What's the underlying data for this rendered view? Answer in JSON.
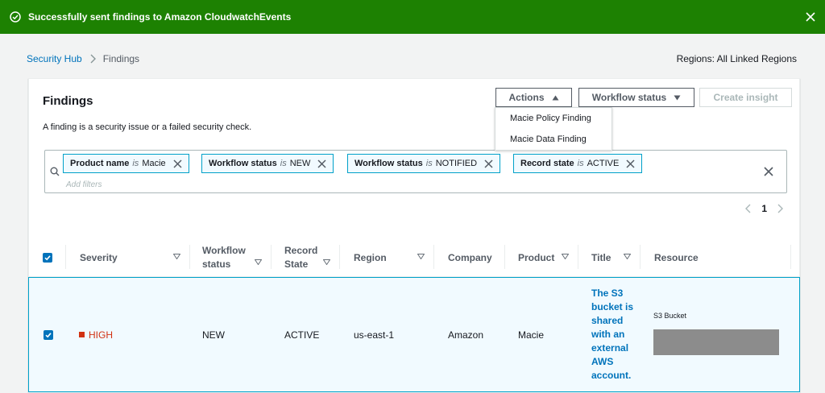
{
  "flash": {
    "message": "Successfully sent findings to Amazon CloudwatchEvents",
    "icon": "check-circle-icon",
    "close_icon": "close-icon",
    "color": "#1d8102"
  },
  "breadcrumb": {
    "parent": "Security Hub",
    "current": "Findings"
  },
  "regions": "Regions: All Linked Regions",
  "findings": {
    "title": "Findings",
    "description": "A finding is a security issue or a failed security check.",
    "actions_label": "Actions",
    "workflow_label": "Workflow status",
    "create_insight_label": "Create insight",
    "actions_menu": [
      "Macie Policy Finding",
      "Macie Data Finding"
    ]
  },
  "filters": {
    "tokens": [
      {
        "key": "Product name",
        "op": "is",
        "value": "Macie"
      },
      {
        "key": "Workflow status",
        "op": "is",
        "value": "NEW"
      },
      {
        "key": "Workflow status",
        "op": "is",
        "value": "NOTIFIED"
      },
      {
        "key": "Record state",
        "op": "is",
        "value": "ACTIVE"
      }
    ],
    "placeholder": "Add filters"
  },
  "pagination": {
    "current_page": "1"
  },
  "table": {
    "columns": {
      "severity": "Severity",
      "workflow_line1": "Workflow",
      "workflow_line2": "status",
      "record_line1": "Record",
      "record_line2": "State",
      "region": "Region",
      "company": "Company",
      "product": "Product",
      "title": "Title",
      "resource": "Resource"
    },
    "rows": [
      {
        "selected": true,
        "severity": "HIGH",
        "workflow": "NEW",
        "record_state": "ACTIVE",
        "region": "us-east-1",
        "company": "Amazon",
        "product": "Macie",
        "title": "The S3 bucket is shared with an external AWS account.",
        "resource_type": "S3 Bucket"
      }
    ]
  },
  "colors": {
    "accent": "#0073bb",
    "severity_high": "#d13212",
    "selected_row_bg": "#f1faff",
    "selected_row_border": "#00a1c9"
  }
}
